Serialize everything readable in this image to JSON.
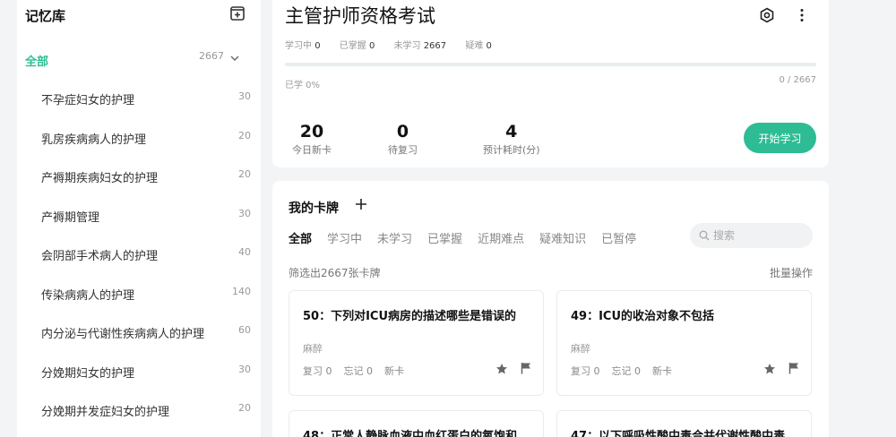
{
  "sidebar": {
    "title": "记忆库",
    "all": {
      "label": "全部",
      "count": "2667"
    },
    "items": [
      {
        "label": "不孕症妇女的护理",
        "count": "30"
      },
      {
        "label": "乳房疾病病人的护理",
        "count": "20"
      },
      {
        "label": "产褥期疾病妇女的护理",
        "count": "20"
      },
      {
        "label": "产褥期管理",
        "count": "30"
      },
      {
        "label": "会阴部手术病人的护理",
        "count": "40"
      },
      {
        "label": "传染病病人的护理",
        "count": "140"
      },
      {
        "label": "内分泌与代谢性疾病病人的护理",
        "count": "60"
      },
      {
        "label": "分娩期妇女的护理",
        "count": "30"
      },
      {
        "label": "分娩期并发症妇女的护理",
        "count": "20"
      }
    ]
  },
  "overview": {
    "title": "主管护师资格考试",
    "stats": [
      {
        "label": "学习中",
        "value": "0"
      },
      {
        "label": "已掌握",
        "value": "0"
      },
      {
        "label": "未学习",
        "value": "2667"
      },
      {
        "label": "疑难",
        "value": "0"
      }
    ],
    "progress_fraction": 0,
    "learned_text": "已学 0%",
    "ratio_text": "0 / 2667",
    "kpis": [
      {
        "value": "20",
        "label": "今日新卡"
      },
      {
        "value": "0",
        "label": "待复习"
      },
      {
        "value": "4",
        "label": "预计耗时(分)"
      }
    ],
    "start_label": "开始学习"
  },
  "cards_section": {
    "title": "我的卡牌",
    "tabs": [
      "全部",
      "学习中",
      "未学习",
      "已掌握",
      "近期难点",
      "疑难知识",
      "已暂停"
    ],
    "search_placeholder": "搜索",
    "filter_count": "筛选出2667张卡牌",
    "bulk_label": "批量操作",
    "cards": [
      {
        "title": "50：下列对ICU病房的描述哪些是错误的",
        "tag": "麻醉",
        "review": "复习 0",
        "forget": "忘记 0",
        "status": "新卡"
      },
      {
        "title": "49：ICU的收治对象不包括",
        "tag": "麻醉",
        "review": "复习 0",
        "forget": "忘记 0",
        "status": "新卡"
      },
      {
        "title": "48：正常人静脉血液中血红蛋白的氧饱和"
      },
      {
        "title": "47：以下呼吸性酸中毒合并代谢性酸中毒"
      }
    ]
  },
  "colors": {
    "accent": "#2dbc94"
  },
  "icons": {
    "add_deck": "plus-square-icon",
    "settings": "settings-icon",
    "more": "more-vertical-icon",
    "search": "search-icon",
    "star": "star-icon",
    "flag": "flag-icon"
  }
}
